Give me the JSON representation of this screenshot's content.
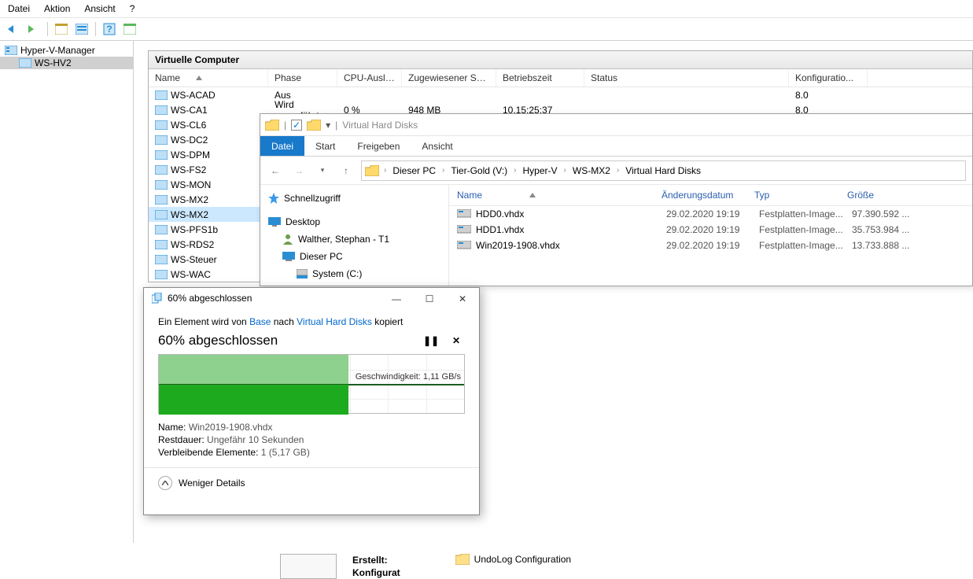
{
  "menubar": {
    "file": "Datei",
    "action": "Aktion",
    "view": "Ansicht",
    "help": "?"
  },
  "tree": {
    "root": "Hyper-V-Manager",
    "host": "WS-HV2"
  },
  "vc": {
    "title": "Virtuelle Computer",
    "cols": {
      "name": "Name",
      "phase": "Phase",
      "cpu": "CPU-Auslast...",
      "mem": "Zugewiesener Spei...",
      "uptime": "Betriebszeit",
      "status": "Status",
      "conf": "Konfiguratio..."
    },
    "rows": [
      {
        "name": "WS-ACAD",
        "phase": "Aus",
        "cpu": "",
        "mem": "",
        "uptime": "",
        "status": "",
        "conf": "8.0"
      },
      {
        "name": "WS-CA1",
        "phase": "Wird ausgeführt",
        "cpu": "0 %",
        "mem": "948 MB",
        "uptime": "10.15:25:37",
        "status": "",
        "conf": "8.0"
      },
      {
        "name": "WS-CL6"
      },
      {
        "name": "WS-DC2"
      },
      {
        "name": "WS-DPM"
      },
      {
        "name": "WS-FS2"
      },
      {
        "name": "WS-MON"
      },
      {
        "name": "WS-MX2"
      },
      {
        "name": "WS-MX2",
        "sel": true
      },
      {
        "name": "WS-PFS1b"
      },
      {
        "name": "WS-RDS2"
      },
      {
        "name": "WS-Steuer"
      },
      {
        "name": "WS-WAC"
      }
    ]
  },
  "explorer": {
    "winTitle": "Virtual Hard Disks",
    "tabs": {
      "file": "Datei",
      "start": "Start",
      "share": "Freigeben",
      "view": "Ansicht"
    },
    "breadcrumb": [
      "Dieser PC",
      "Tier-Gold (V:)",
      "Hyper-V",
      "WS-MX2",
      "Virtual Hard Disks"
    ],
    "treeItems": {
      "quick": "Schnellzugriff",
      "desktop": "Desktop",
      "user": "Walther, Stephan - T1",
      "thispc": "Dieser PC",
      "sysc": "System (C:)"
    },
    "cols": {
      "name": "Name",
      "date": "Änderungsdatum",
      "type": "Typ",
      "size": "Größe"
    },
    "files": [
      {
        "name": "HDD0.vhdx",
        "date": "29.02.2020 19:19",
        "type": "Festplatten-Image...",
        "size": "97.390.592 ..."
      },
      {
        "name": "HDD1.vhdx",
        "date": "29.02.2020 19:19",
        "type": "Festplatten-Image...",
        "size": "35.753.984 ..."
      },
      {
        "name": "Win2019-1908.vhdx",
        "date": "29.02.2020 19:19",
        "type": "Festplatten-Image...",
        "size": "13.733.888 ..."
      }
    ]
  },
  "copy": {
    "title": "60% abgeschlossen",
    "caption_tpl": "Ein Element wird von {src} nach {dst} kopiert",
    "caption_pre": "Ein Element wird von ",
    "caption_mid": " nach ",
    "caption_post": " kopiert",
    "src": "Base",
    "dst": "Virtual Hard Disks",
    "pct": "60% abgeschlossen",
    "progress_pct": 62,
    "speed_label": "Geschwindigkeit: 1,11 GB/s",
    "name_lbl": "Name:",
    "name_val": "Win2019-1908.vhdx",
    "remain_lbl": "Restdauer:",
    "remain_val": "Ungefähr 10 Sekunden",
    "left_lbl": "Verbleibende Elemente:",
    "left_val": "1 (5,17 GB)",
    "less": "Weniger Details"
  },
  "bottom": {
    "created": "Erstellt:",
    "config": "Konfigurat",
    "undo": "UndoLog Configuration"
  }
}
